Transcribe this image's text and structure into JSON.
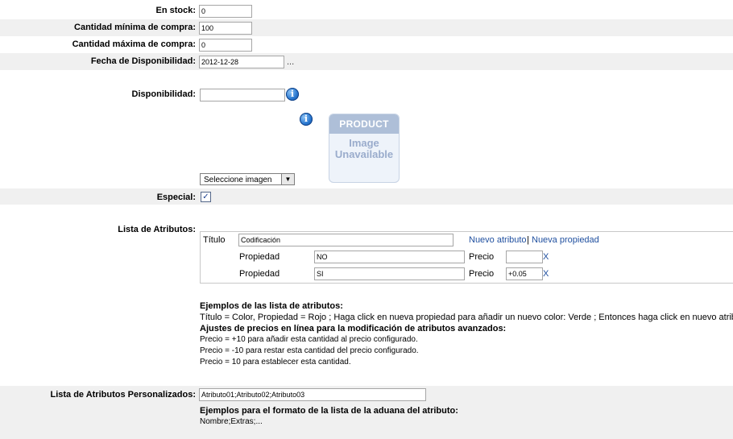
{
  "fields": {
    "stock": {
      "label": "En stock:",
      "value": "0"
    },
    "min_qty": {
      "label": "Cantidad mínima de compra:",
      "value": "100"
    },
    "max_qty": {
      "label": "Cantidad máxima de compra:",
      "value": "0"
    },
    "avail_date": {
      "label": "Fecha de Disponibilidad:",
      "value": "2012-12-28",
      "picker": "..."
    },
    "availability": {
      "label": "Disponibilidad:",
      "value": ""
    },
    "special": {
      "label": "Especial:",
      "checked": true,
      "check_glyph": "✓"
    },
    "custom_attrs": {
      "label": "Lista de Atributos Personalizados:",
      "value": "Atributo01;Atributo02;Atributo03"
    }
  },
  "image": {
    "placeholder_top": "PRODUCT",
    "placeholder_line1": "Image",
    "placeholder_line2": "Unavailable",
    "select_value": "Seleccione imagen",
    "select_arrow": "▼"
  },
  "info_glyph": "i",
  "attributes": {
    "label": "Lista de Atributos:",
    "title_label": "Título",
    "title_value": "Codificación",
    "new_attribute": "Nuevo atributo",
    "separator": "|",
    "new_property": "Nueva propiedad",
    "properties": [
      {
        "label": "Propiedad",
        "value": "NO",
        "price_label": "Precio",
        "price": "",
        "remove": "X"
      },
      {
        "label": "Propiedad",
        "value": "SI",
        "price_label": "Precio",
        "price": "+0.05",
        "remove": "X"
      }
    ]
  },
  "help": {
    "heading1": "Ejemplos de las lista de atributos:",
    "example1": "Título = Color, Propiedad = Rojo ; Haga click en nueva propiedad para añadir un nuevo color: Verde ; Entonces haga click en nuevo atributo",
    "heading2": "Ajustes de precios en línea para la modificación de atributos avanzados:",
    "line1": "Precio = +10 para añadir esta cantidad al precio configurado.",
    "line2": "Precio = -10 para restar esta cantidad del precio configurado.",
    "line3": "Precio = 10 para establecer esta cantidad."
  },
  "custom_help": {
    "heading": "Ejemplos para el formato de la lista de la aduana del atributo:",
    "example": "Nombre;Extras;..."
  }
}
